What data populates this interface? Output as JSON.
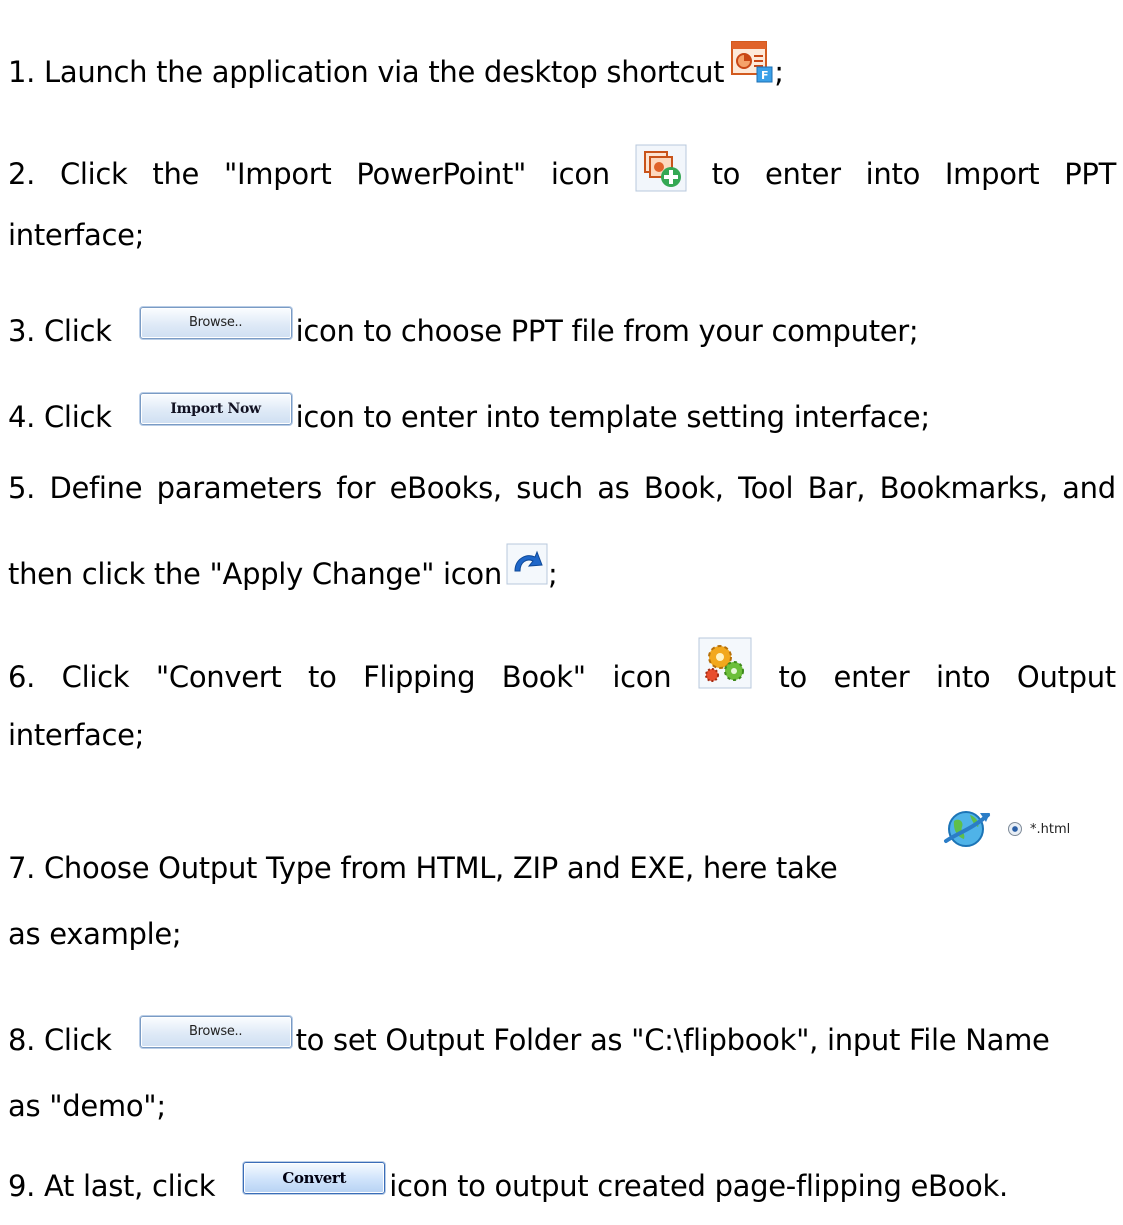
{
  "steps": [
    {
      "parts": [
        "1. Launch the application via the desktop shortcut",
        ";"
      ],
      "icon": "flipbook-app-shortcut-icon"
    },
    {
      "parts": [
        "2.",
        "Click",
        "the",
        "\"Import",
        "PowerPoint\"",
        "icon",
        "to",
        "enter",
        "into",
        "Import",
        "PPT"
      ],
      "cont": "interface;",
      "icon": "import-powerpoint-icon"
    },
    {
      "parts": [
        "3. Click",
        "icon to choose PPT file from your computer;"
      ],
      "button": "Browse.."
    },
    {
      "parts": [
        "4. Click",
        "icon to enter into template setting interface;"
      ],
      "button": "Import Now"
    },
    {
      "parts": [
        "5.",
        "Define",
        "parameters",
        "for",
        "eBooks,",
        "such",
        "as",
        "Book,",
        "Tool",
        "Bar,",
        "Bookmarks,",
        "and"
      ],
      "cont": [
        "then click the \"Apply Change\" icon",
        ";"
      ],
      "icon": "apply-change-icon"
    },
    {
      "parts": [
        "6.",
        "Click",
        "\"Convert",
        "to",
        "Flipping",
        "Book\"",
        "icon",
        "to",
        "enter",
        "into",
        "Output"
      ],
      "cont": "interface;",
      "icon": "convert-flipping-book-icon"
    },
    {
      "parts": [
        "7. Choose Output Type from HTML, ZIP and EXE, here take"
      ],
      "cont": "as example;",
      "radio_label": "*.html"
    },
    {
      "parts": [
        "8. Click",
        "to set Output Folder as \"C:\\flipbook\", input File Name"
      ],
      "cont": "as \"demo\";",
      "button": "Browse.."
    },
    {
      "parts": [
        "9. At last, click",
        "icon to output created page-flipping eBook."
      ],
      "button": "Convert"
    }
  ],
  "colors": {
    "button_border": "#7a9bc4",
    "button_bg": "#dfeaf7"
  }
}
